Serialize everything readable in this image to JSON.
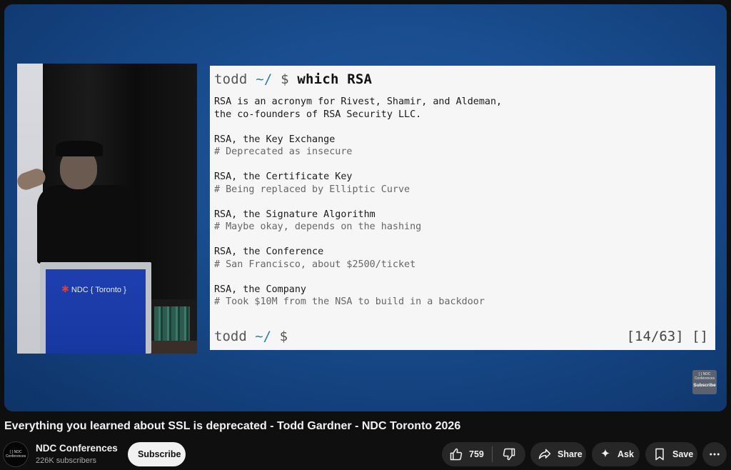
{
  "slide": {
    "prompt_user": "todd",
    "prompt_path": "~/",
    "prompt_sym": "$",
    "command": "which RSA",
    "intro_line1": "RSA is an acronym for Rivest, Shamir, and Aldeman,",
    "intro_line2": "the co-founders of RSA Security LLC.",
    "items": [
      {
        "heading": "RSA, the Key Exchange",
        "comment": "# Deprecated as insecure"
      },
      {
        "heading": "RSA, the Certificate Key",
        "comment": "# Being replaced by Elliptic Curve"
      },
      {
        "heading": "RSA, the Signature Algorithm",
        "comment": "# Maybe okay, depends on the hashing"
      },
      {
        "heading": "RSA, the Conference",
        "comment": "# San Francisco, about $2500/ticket"
      },
      {
        "heading": "RSA, the Company",
        "comment": "# Took $10M from the NSA to build in a backdoor"
      }
    ],
    "counter": "[14/63]",
    "counter_suffix": "[]"
  },
  "stage": {
    "podium_logo": "NDC { Toronto }"
  },
  "watermark": {
    "text": "{ } NDC Conferences",
    "subscribe": "Subscribe"
  },
  "video": {
    "title": "Everything you learned about SSL is deprecated - Todd Gardner - NDC Toronto 2026"
  },
  "channel": {
    "name": "NDC Conferences",
    "subscribers": "226K subscribers",
    "avatar_text": "{ } NDC Conferences",
    "subscribe_label": "Subscribe"
  },
  "actions": {
    "like_count": "759",
    "share": "Share",
    "ask": "Ask",
    "save": "Save"
  },
  "icons": [
    "thumbs-up-icon",
    "thumbs-down-icon",
    "share-arrow-icon",
    "sparkle-icon",
    "bookmark-icon",
    "more-vertical-icon"
  ]
}
